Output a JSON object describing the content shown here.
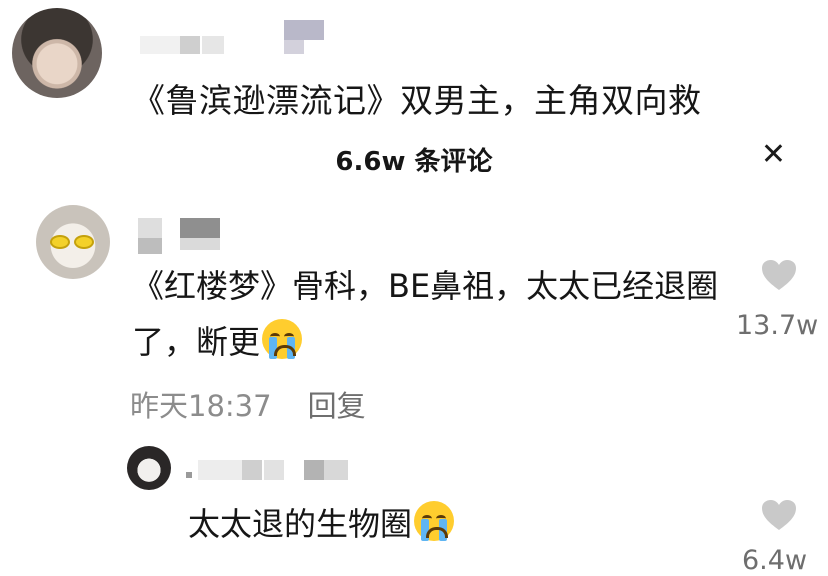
{
  "post": {
    "title": "《鲁滨逊漂流记》双男主，主角双向救"
  },
  "comments_panel": {
    "header": "6.6w 条评论",
    "close_icon": "close-icon"
  },
  "comments": [
    {
      "text": "《红楼梦》骨科，BE鼻祖，太太已经退圈了，断更",
      "emoji": "loudly-crying-face",
      "time": "昨天18:37",
      "reply_label": "回复",
      "likes": "13.7w"
    }
  ],
  "replies": [
    {
      "text": "太太退的生物圈",
      "emoji": "loudly-crying-face",
      "likes": "6.4w"
    }
  ],
  "colors": {
    "background": "#ffffff",
    "text": "#161616",
    "muted": "#8c8c8c",
    "heart": "#c9c9c9",
    "emoji": "#ffcd2e"
  }
}
